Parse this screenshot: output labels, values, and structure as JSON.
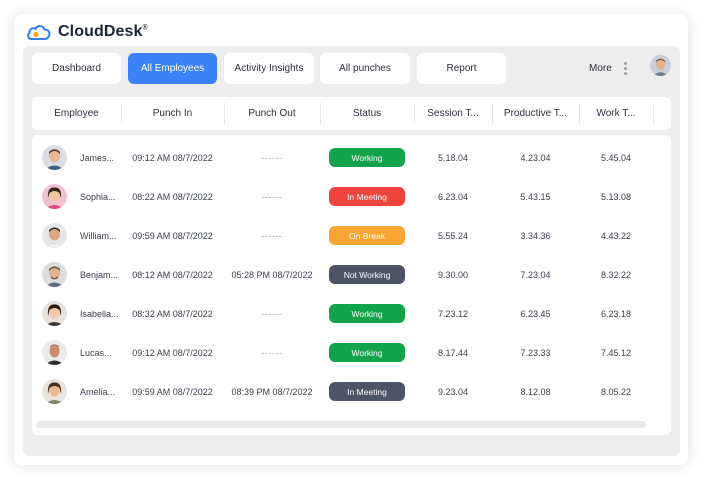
{
  "brand": {
    "name": "CloudDesk",
    "trademark": "®"
  },
  "tabs": [
    {
      "label": "Dashboard",
      "active": false
    },
    {
      "label": "All Employees",
      "active": true
    },
    {
      "label": "Activity Insights",
      "active": false
    },
    {
      "label": "All punches",
      "active": false
    },
    {
      "label": "Report",
      "active": false
    }
  ],
  "more_label": "More",
  "colors": {
    "accent": "#3b82f6",
    "working": "#13a34a",
    "in_meeting_red": "#f0443c",
    "on_break": "#f8a532",
    "not_working": "#4b5565",
    "in_meeting_gray": "#4b5565"
  },
  "table": {
    "columns": [
      "Employee",
      "Punch In",
      "Punch Out",
      "Status",
      "Session T...",
      "Productive T...",
      "Work T..."
    ],
    "rows": [
      {
        "employee": "James...",
        "punch_in": "09:12 AM 08/7/2022",
        "punch_out": "------",
        "status": "Working",
        "status_color": "#13a34a",
        "session": "5.18.04",
        "productive": "4.23.04",
        "work": "5.45.04"
      },
      {
        "employee": "Sophia...",
        "punch_in": "08:22 AM 08/7/2022",
        "punch_out": "------",
        "status": "In Meeting",
        "status_color": "#f0443c",
        "session": "6.23.04",
        "productive": "5.43.15",
        "work": "5.13.08"
      },
      {
        "employee": "William...",
        "punch_in": "09:59 AM 08/7/2022",
        "punch_out": "------",
        "status": "On Break",
        "status_color": "#f8a532",
        "session": "5.55.24",
        "productive": "3.34.36",
        "work": "4.43.22"
      },
      {
        "employee": "Benjam...",
        "punch_in": "08:12 AM 08/7/2022",
        "punch_out": "05:28 PM 08/7/2022",
        "status": "Not Working",
        "status_color": "#4b5565",
        "session": "9.30.00",
        "productive": "7.23.04",
        "work": "8.32.22"
      },
      {
        "employee": "Isabella...",
        "punch_in": "08:32 AM 08/7/2022",
        "punch_out": "------",
        "status": "Working",
        "status_color": "#13a34a",
        "session": "7.23.12",
        "productive": "6.23.45",
        "work": "6.23.18"
      },
      {
        "employee": "Lucas...",
        "punch_in": "09:12 AM 08/7/2022",
        "punch_out": "------",
        "status": "Working",
        "status_color": "#13a34a",
        "session": "8.17.44",
        "productive": "7.23.33",
        "work": "7.45.12"
      },
      {
        "employee": "Amelia...",
        "punch_in": "09:59 AM 08/7/2022",
        "punch_out": "08:39 PM 08/7/2022",
        "status": "In Meeting",
        "status_color": "#4b5565",
        "session": "9.23.04",
        "productive": "8.12.08",
        "work": "8.05.22"
      }
    ]
  }
}
